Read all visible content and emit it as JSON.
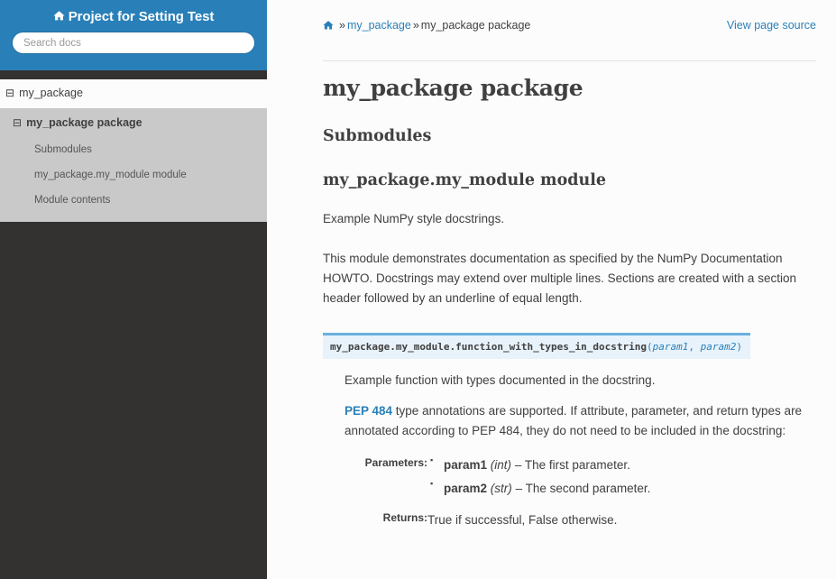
{
  "sidebar": {
    "brand": {
      "icon": "home-icon",
      "title": "Project for Setting Test"
    },
    "search": {
      "placeholder": "Search docs",
      "value": ""
    },
    "nav": {
      "level1": {
        "label": "my_package",
        "icon": "minus-square-icon"
      },
      "level2": {
        "label": "my_package package",
        "icon": "minus-square-icon"
      },
      "level3": [
        {
          "label": "Submodules"
        },
        {
          "label": "my_package.my_module module"
        },
        {
          "label": "Module contents"
        }
      ]
    }
  },
  "breadcrumb": {
    "home_icon": "home-icon",
    "sep1": "»",
    "item1": "my_package",
    "sep2": "»",
    "item2": "my_package package",
    "view_source": "View page source"
  },
  "main": {
    "h1": "my_package package",
    "h2_submodules": "Submodules",
    "h2_module": "my_package.my_module module",
    "p1": "Example NumPy style docstrings.",
    "p2": "This module demonstrates documentation as specified by the NumPy Documentation HOWTO. Docstrings may extend over multiple lines. Sections are created with a section header followed by an underline of equal length.",
    "signature": {
      "name": "my_package.my_module.function_with_types_in_docstring",
      "open_paren": "(",
      "param1": "param1",
      "comma": ", ",
      "param2": "param2",
      "close_paren": ")"
    },
    "desc1": "Example function with types documented in the docstring.",
    "desc2_link": "PEP 484",
    "desc2_rest": " type annotations are supported. If attribute, parameter, and return types are annotated according to PEP 484, they do not need to be included in the docstring:",
    "fields": {
      "parameters_label": "Parameters:",
      "parameters": [
        {
          "name": "param1",
          "type": "(int)",
          "dash": "–",
          "desc": "The first parameter."
        },
        {
          "name": "param2",
          "type": "(str)",
          "dash": "–",
          "desc": "The second parameter."
        }
      ],
      "returns_label": "Returns:",
      "returns_value": "True if successful, False otherwise."
    }
  },
  "colors": {
    "brand_blue": "#2980b9",
    "sidebar_dark": "#343131",
    "nav_l2_bg": "#c9c9c9",
    "link_blue": "#2980b9",
    "sig_bg": "#e7f2fa",
    "sig_border": "#6ab0de",
    "text": "#404040",
    "page_bg": "#fcfcfc"
  }
}
